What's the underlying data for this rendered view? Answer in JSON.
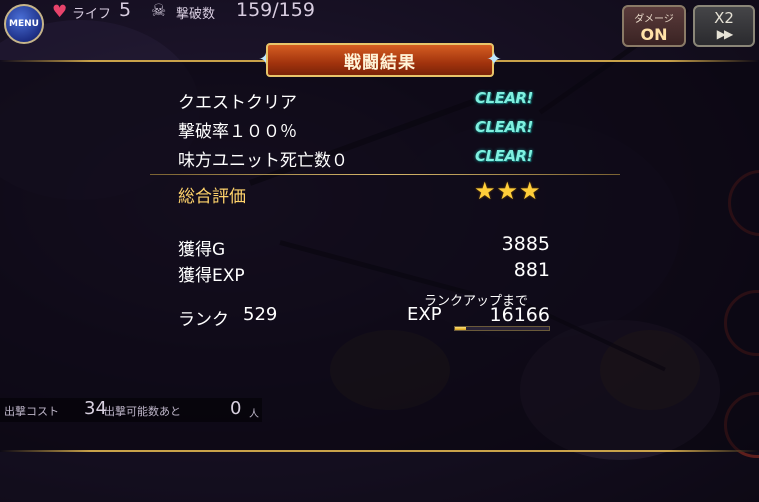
{
  "hud": {
    "menu_label": "MENU",
    "life_icon": "heart-icon",
    "life_label": "ライフ",
    "life_value": "5",
    "kill_icon": "skull-icon",
    "kill_label": "撃破数",
    "kill_value": "159/159",
    "damage_button": {
      "title": "ダメージ",
      "state": "ON"
    },
    "speed_button": {
      "label": "X2",
      "icon": "fast-forward-icon"
    }
  },
  "result": {
    "title": "戦闘結果",
    "objectives": [
      {
        "label": "クエストクリア",
        "status": "CLEAR!"
      },
      {
        "label": "撃破率１００％",
        "status": "CLEAR!"
      },
      {
        "label": "味方ユニット死亡数０",
        "status": "CLEAR!"
      }
    ],
    "overall_label": "総合評価",
    "stars": "★★★",
    "star_count": 3,
    "gold_label": "獲得G",
    "gold_value": "3885",
    "exp_label": "獲得EXP",
    "exp_value": "881",
    "rank_label": "ランク",
    "rank_value": "529",
    "next_rank_label": "ランクアップまで",
    "next_exp_label": "EXP",
    "next_exp_value": "16166",
    "exp_progress": 0.12
  },
  "bottom": {
    "sortie_cost_label": "出撃コスト",
    "sortie_cost_value": "34",
    "remaining_label": "出撃可能数あと",
    "remaining_value": "0",
    "remaining_unit": "人"
  },
  "colors": {
    "accent_gold": "#c9a24a",
    "title_orange": "#d55e22",
    "clear_cyan": "#7ff0e0",
    "star_yellow": "#ffce3a"
  }
}
